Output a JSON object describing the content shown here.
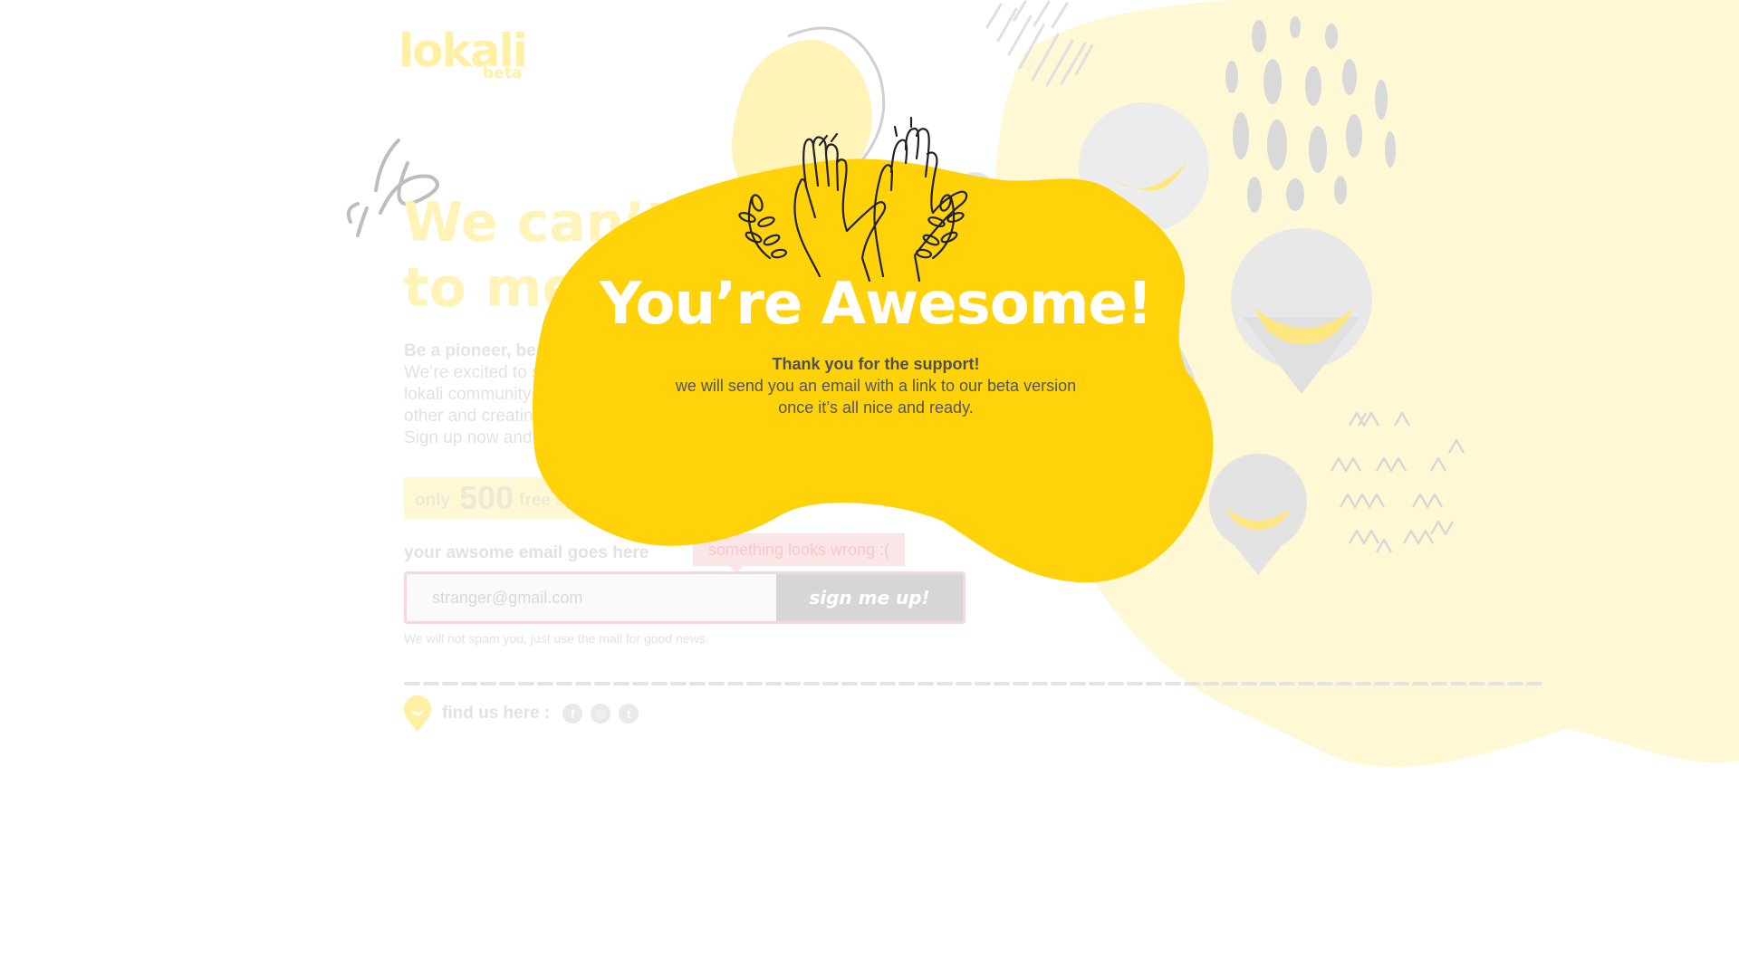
{
  "brand": {
    "logo_text": "lokali",
    "logo_sub": "beta"
  },
  "hero": {
    "title_line1": "We can’t wait",
    "title_line2": "to meet you"
  },
  "intro": {
    "heading": "Be a pioneer, be",
    "lines": [
      "We’re excited to s",
      "lokali community",
      "other and creating",
      "Sign up now and"
    ]
  },
  "spots": {
    "prefix": "only",
    "number": "500",
    "suffix": "free sp"
  },
  "form": {
    "label": "your awsome email goes here",
    "placeholder": "stranger@gmail.com",
    "button": "sign me up!",
    "error": "something looks wrong :(",
    "note": "We will not spam you, just use the mail for good news."
  },
  "footer": {
    "find_label": "find us here :",
    "social": [
      "facebook-icon",
      "instagram-icon",
      "twitter-icon"
    ]
  },
  "modal": {
    "title": "You’re Awesome!",
    "message_heading": "Thank you for the support!",
    "message_lines": [
      "we will send you an email with a link to our beta version",
      "once it’s all nice and ready."
    ]
  },
  "colors": {
    "yellow": "#ffd20a",
    "faded_yellow": "#fff8d4",
    "grey_text": "#555555"
  }
}
